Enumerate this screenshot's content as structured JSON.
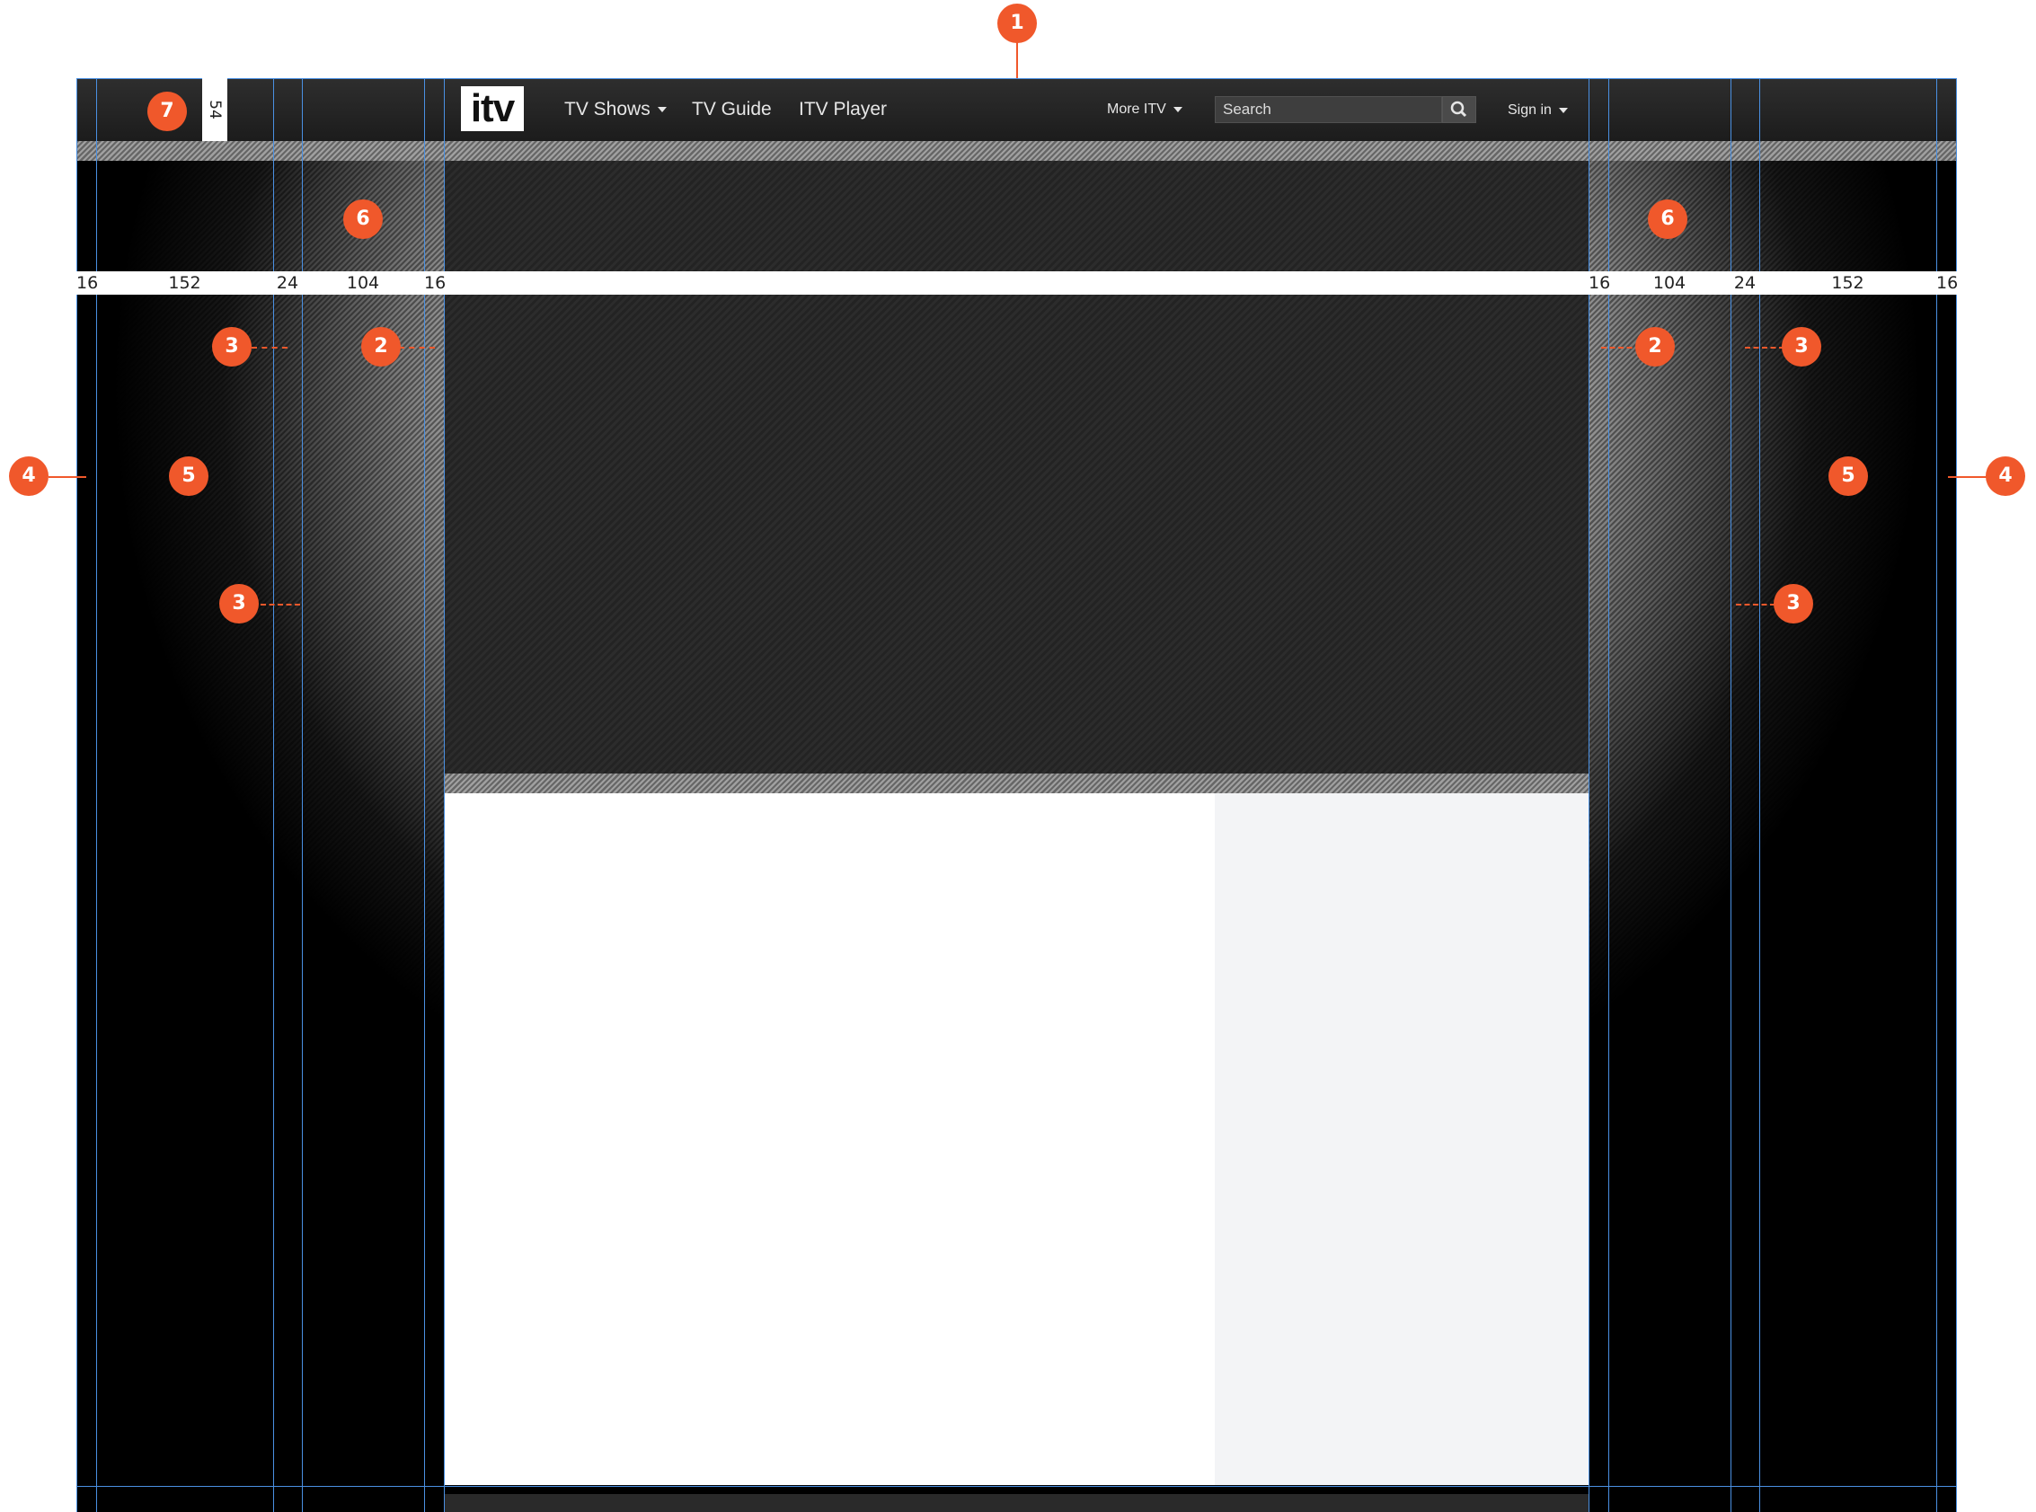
{
  "header": {
    "logo": "itv",
    "nav": [
      {
        "label": "TV Shows",
        "has_dropdown": true
      },
      {
        "label": "TV Guide",
        "has_dropdown": false
      },
      {
        "label": "ITV Player",
        "has_dropdown": false
      }
    ],
    "more": {
      "label": "More ITV",
      "has_dropdown": true
    },
    "search": {
      "placeholder": "Search",
      "icon": "search-icon"
    },
    "signin": {
      "label": "Sign in",
      "has_dropdown": true
    }
  },
  "measurements": {
    "left": [
      "16",
      "152",
      "24",
      "104",
      "16"
    ],
    "right": [
      "16",
      "104",
      "24",
      "152",
      "16"
    ],
    "header_height": "54"
  },
  "callouts": {
    "one": "1",
    "two": "2",
    "three": "3",
    "four": "4",
    "five": "5",
    "six": "6",
    "seven": "7"
  },
  "colors": {
    "callout": "#f0582b",
    "guide": "#4a90e2",
    "header": "#242424",
    "sidebar": "#f3f4f6"
  }
}
